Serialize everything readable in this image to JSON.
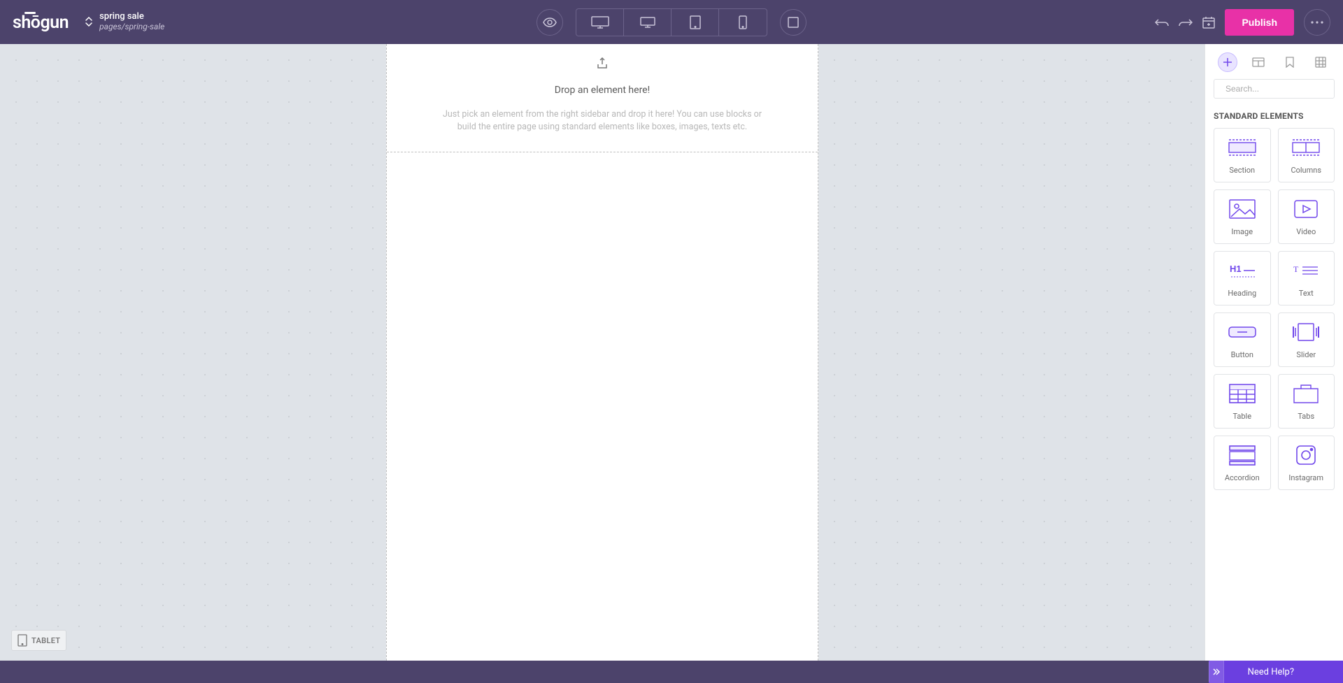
{
  "brand": "shōgun",
  "page": {
    "title": "spring sale",
    "path": "pages/spring-sale"
  },
  "header": {
    "publish_label": "Publish"
  },
  "canvas": {
    "drop_title": "Drop an element here!",
    "drop_desc": "Just pick an element from the right sidebar and drop it here! You can use blocks or build the entire page using standard elements like boxes, images, texts etc.",
    "viewport_badge": "TABLET"
  },
  "sidebar": {
    "search_placeholder": "Search...",
    "section_title": "STANDARD ELEMENTS",
    "elements": [
      {
        "key": "section",
        "label": "Section"
      },
      {
        "key": "columns",
        "label": "Columns"
      },
      {
        "key": "image",
        "label": "Image"
      },
      {
        "key": "video",
        "label": "Video"
      },
      {
        "key": "heading",
        "label": "Heading"
      },
      {
        "key": "text",
        "label": "Text"
      },
      {
        "key": "button",
        "label": "Button"
      },
      {
        "key": "slider",
        "label": "Slider"
      },
      {
        "key": "table",
        "label": "Table"
      },
      {
        "key": "tabs",
        "label": "Tabs"
      },
      {
        "key": "accordion",
        "label": "Accordion"
      },
      {
        "key": "instagram",
        "label": "Instagram"
      }
    ]
  },
  "footer": {
    "help_label": "Need Help?"
  }
}
